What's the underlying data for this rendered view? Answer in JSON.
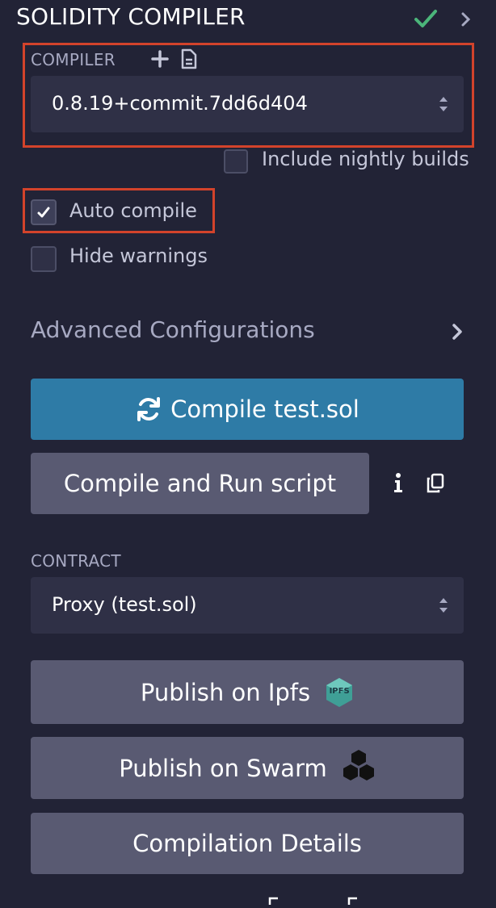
{
  "panel": {
    "title": "SOLIDITY COMPILER"
  },
  "compiler": {
    "label": "COMPILER",
    "selected_version": "0.8.19+commit.7dd6d404",
    "nightly_label": "Include nightly builds",
    "nightly_checked": false
  },
  "options": {
    "auto_compile_label": "Auto compile",
    "auto_compile_checked": true,
    "hide_warnings_label": "Hide warnings",
    "hide_warnings_checked": false
  },
  "advanced": {
    "label": "Advanced Configurations"
  },
  "actions": {
    "compile_label": "Compile test.sol",
    "compile_run_label": "Compile and Run script"
  },
  "contract": {
    "label": "CONTRACT",
    "selected": "Proxy (test.sol)"
  },
  "publish": {
    "ipfs_label": "Publish on Ipfs",
    "ipfs_badge": "IPFS",
    "swarm_label": "Publish on Swarm",
    "details_label": "Compilation Details"
  },
  "colors": {
    "background": "#222336",
    "accent_primary": "#2e7ba6",
    "button_secondary": "#595a72",
    "success_check": "#4bb57a",
    "highlight_box": "#d3432b"
  }
}
